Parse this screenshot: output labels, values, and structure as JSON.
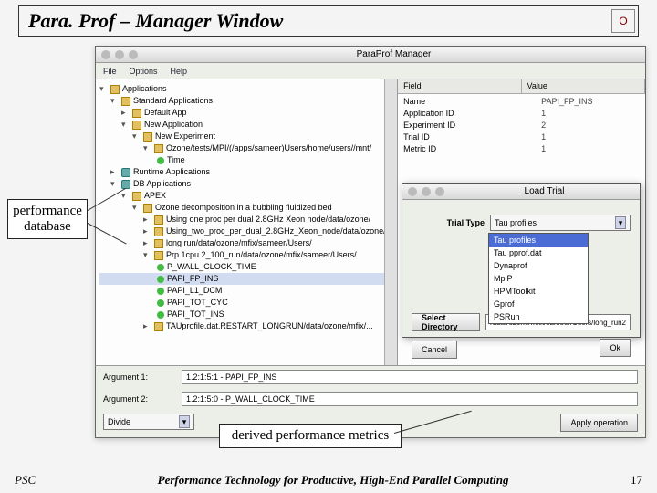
{
  "slide": {
    "title": "Para. Prof  – Manager Window",
    "footer_left": "PSC",
    "footer_center": "Performance Technology for Productive, High-End Parallel Computing",
    "footer_right": "17"
  },
  "annotations": {
    "perfdb_l1": "performance",
    "perfdb_l2": "database",
    "derived": "derived performance metrics"
  },
  "manager": {
    "title": "ParaProf Manager",
    "menu": {
      "file": "File",
      "options": "Options",
      "help": "Help"
    },
    "right_header": {
      "field": "Field",
      "value": "Value"
    },
    "kv": [
      {
        "k": "Name",
        "v": "PAPI_FP_INS"
      },
      {
        "k": "Application ID",
        "v": "1"
      },
      {
        "k": "Experiment ID",
        "v": "2"
      },
      {
        "k": "Trial ID",
        "v": "1"
      },
      {
        "k": "Metric ID",
        "v": "1"
      }
    ],
    "tree": {
      "apps": "Applications",
      "std": "Standard Applications",
      "defapp": "Default App",
      "newapp": "New Application",
      "newexp": "New Experiment",
      "path1": "Ozone/tests/MPI/(/apps/sameer)Users/home/users//mnt/",
      "runtime": "Runtime Applications",
      "dbapps": "DB Applications",
      "apix": "APEX",
      "oz": "Ozone decomposition in a bubbling fluidized bed",
      "u1": "Using one proc per dual 2.8GHz Xeon node/data/ozone/",
      "u2": "Using_two_proc_per_dual_2.8GHz_Xeon_node/data/ozone/",
      "u3": "long run/data/ozone/mfix/sameer/Users/",
      "u4": "Prp.1cpu.2_100_run/data/ozone/mfix/sameer/Users/",
      "m0": "P_WALL_CLOCK_TIME",
      "m1": "PAPI_FP_INS",
      "m2": "PAPI_L1_DCM",
      "m3": "PAPI_TOT_CYC",
      "m4": "PAPI_TOT_INS",
      "m5": "TAUprofile.dat.RESTART_LONGRUN/data/ozone/mfix/..."
    }
  },
  "dialog": {
    "title": "Load Trial",
    "trial_type_lbl": "Trial Type",
    "trial_type_val": "Tau profiles",
    "select_dir": "Select Directory",
    "path": "/data/ozone/mfix/sameer/Users/long_run2",
    "cancel": "Cancel",
    "ok": "Ok",
    "options": [
      "Tau profiles",
      "Tau pprof.dat",
      "Dynaprof",
      "MpiP",
      "HPMToolkit",
      "Gprof",
      "PSRun"
    ]
  },
  "bottom": {
    "arg1_lbl": "Argument 1:",
    "arg1_val": "1.2:1:5:1 - PAPI_FP_INS",
    "arg2_lbl": "Argument 2:",
    "arg2_val": "1.2:1:5:0 - P_WALL_CLOCK_TIME",
    "divide": "Divide",
    "apply": "Apply operation"
  }
}
